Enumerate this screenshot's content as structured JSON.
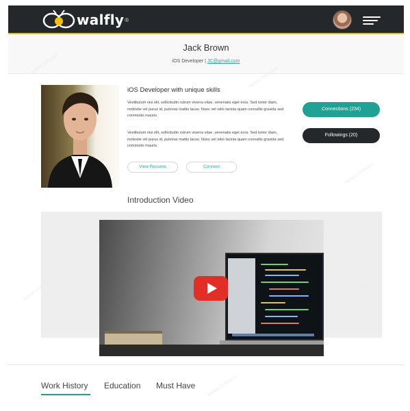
{
  "header": {
    "brand": "walfly",
    "brand_mark": "®"
  },
  "profile": {
    "name": "Jack Brown",
    "role": "iOS Developer",
    "separator": "|",
    "email": "JC@gmail.com",
    "headline": "iOS Developer with unique skills",
    "paragraphs": [
      "Vestibulum nisi elit, sollicitudin rutrum viverra vitae, venenatis eget eros. Sed tortor diam, molestie vel purus id, pulvinar mattis lacus. Nunc vel odio lacinia quam convallis gravida sed commodo mauris.",
      "Vestibulum nisi elit, sollicitudin rutrum viverra vitae, venenatis eget eros. Sed tortor diam, molestie vel purus id, pulvinar mattis lacus. Nunc vel odio lacinia quam convallis gravida sed commodo mauris."
    ],
    "actions": {
      "resume": "View Resume",
      "connect": "Connect"
    },
    "stats": {
      "connections": "Connections (234)",
      "followings": "Followings (20)"
    }
  },
  "video": {
    "title": "Introduction Video"
  },
  "tabs": [
    "Work History",
    "Education",
    "Must Have"
  ],
  "watermark": "Netset Software",
  "colors": {
    "accent": "#1fa293",
    "dark": "#25282b",
    "brand_yellow": "#e6c200",
    "play_red": "#e12e27"
  }
}
